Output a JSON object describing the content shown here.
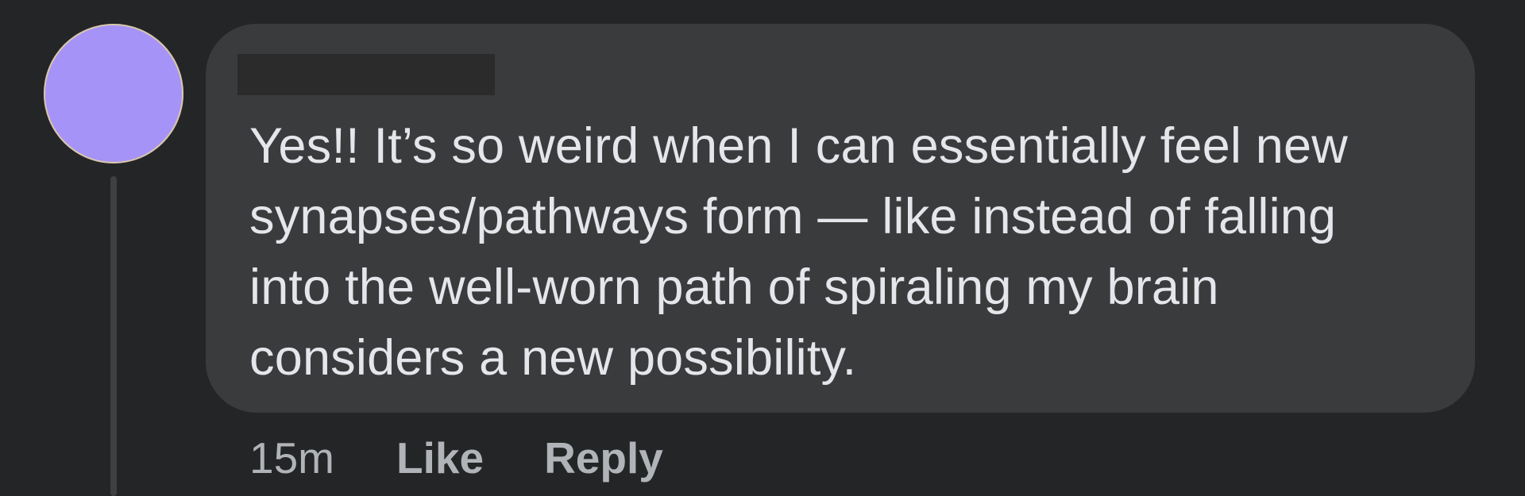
{
  "comment": {
    "author": "",
    "text": "Yes!! It’s so weird when I can essentially feel new\nsynapses/pathways form — like instead of falling\ninto the well-worn path of spiraling my brain\nconsiders a new possibility.",
    "timestamp": "15m",
    "like_label": "Like",
    "reply_label": "Reply"
  },
  "colors": {
    "background": "#242526",
    "bubble": "#3a3b3c",
    "avatar": "#a593f7",
    "text": "#e4e6eb",
    "meta_text": "#b0b3b8"
  }
}
